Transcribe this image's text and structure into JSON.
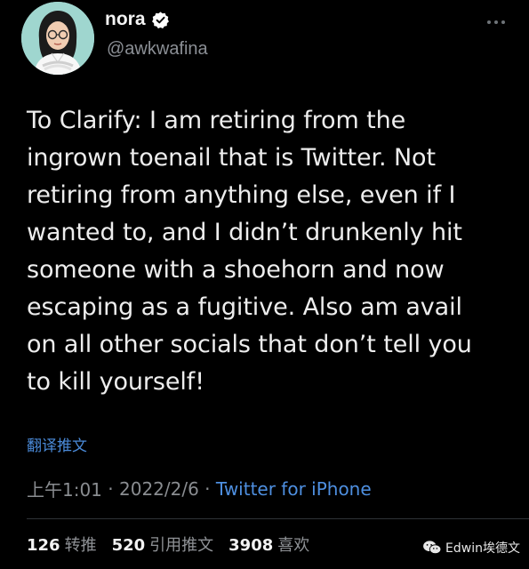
{
  "author": {
    "name": "nora",
    "handle": "@awkwafina"
  },
  "tweet": {
    "text": "To Clarify: I am retiring from the\ningrown toenail that is Twitter. Not\nretiring from anything else, even if I\nwanted to, and I didn’t drunkenly hit\nsomeone with a shoehorn and now\nescaping as a fugitive. Also am avail\non all other socials that don’t tell you\nto kill yourself!",
    "translate_label": "翻译推文",
    "time": "上午1:01",
    "separator1": " · ",
    "date": "2022/2/6",
    "separator2": " · ",
    "source": "Twitter for iPhone"
  },
  "stats": {
    "retweets_count": "126",
    "retweets_label": "转推",
    "quotes_count": "520",
    "quotes_label": "引用推文",
    "likes_count": "3908",
    "likes_label": "喜欢"
  },
  "watermark": {
    "text": "Edwin埃德文"
  },
  "colors": {
    "background": "#000000",
    "link": "#4e8fe0",
    "verified_badge": "#ffffff",
    "secondary_text": "#8a8d91"
  },
  "icons": {
    "verified": "verified-badge-icon",
    "more": "more-options-icon",
    "watermark": "wechat-icon"
  }
}
